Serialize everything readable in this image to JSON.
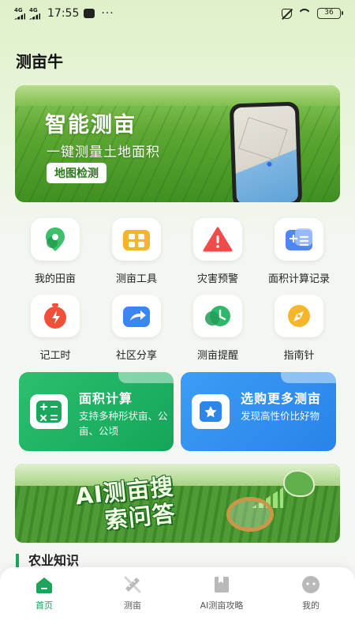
{
  "status_bar": {
    "signal1": "4G",
    "signal2": "4G",
    "time": "17:55",
    "battery": "36"
  },
  "app": {
    "title": "测亩牛"
  },
  "banner": {
    "headline": "智能测亩",
    "subtitle": "一键测量土地面积",
    "button": "地图检测"
  },
  "grid": {
    "items": [
      {
        "label": "我的田亩",
        "icon": "map-pin-icon"
      },
      {
        "label": "测亩工具",
        "icon": "toolbox-icon"
      },
      {
        "label": "灾害预警",
        "icon": "warning-icon"
      },
      {
        "label": "面积计算记录",
        "icon": "calculator-record-icon"
      },
      {
        "label": "记工时",
        "icon": "stopwatch-icon"
      },
      {
        "label": "社区分享",
        "icon": "share-icon"
      },
      {
        "label": "测亩提醒",
        "icon": "clock-icon"
      },
      {
        "label": "指南针",
        "icon": "compass-icon"
      }
    ]
  },
  "cards": {
    "area": {
      "title": "面积计算",
      "desc": "支持多种形状亩、公亩、公顷"
    },
    "shop": {
      "title": "选购更多测亩",
      "desc": "发现高性价比好物"
    }
  },
  "ai_banner": {
    "line1": "AI测亩搜",
    "line2": "索问答"
  },
  "section": {
    "title": "农业知识"
  },
  "tabbar": {
    "tabs": [
      {
        "label": "首页",
        "active": true
      },
      {
        "label": "测亩",
        "active": false
      },
      {
        "label": "AI测亩攻略",
        "active": false
      },
      {
        "label": "我的",
        "active": false
      }
    ]
  },
  "colors": {
    "accent": "#1fa35a",
    "blue": "#2a83e8"
  }
}
